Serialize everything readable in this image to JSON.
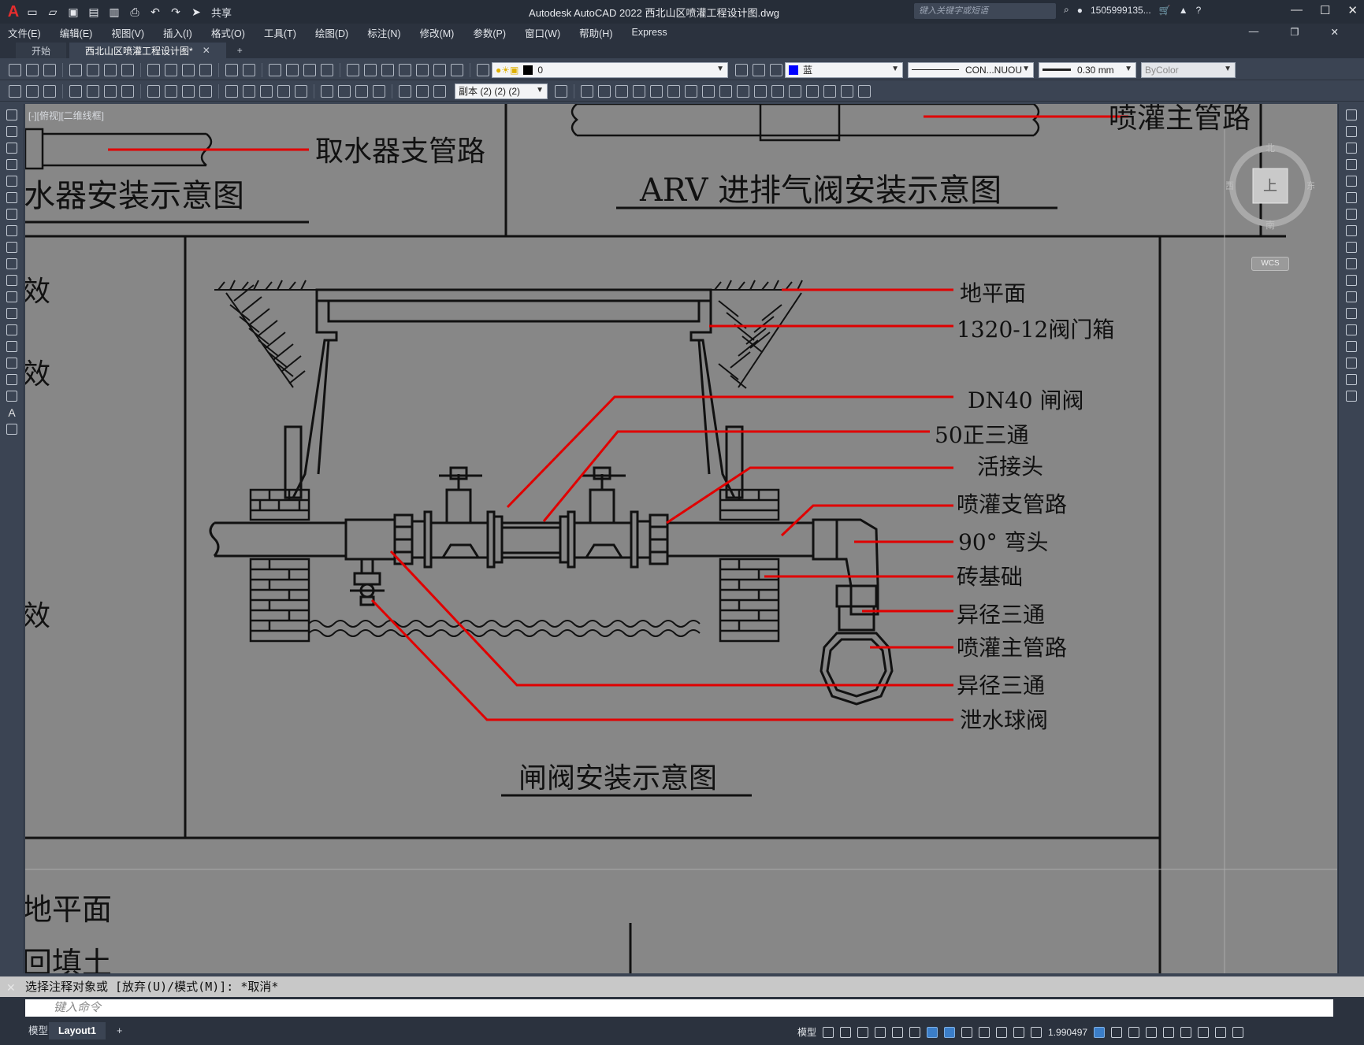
{
  "app": {
    "title": "Autodesk AutoCAD 2022    西北山区喷灌工程设计图.dwg",
    "share_label": "共享",
    "search_placeholder": "键入关键字或短语",
    "user": "1505999135...",
    "help": "?"
  },
  "menu": [
    "文件(E)",
    "编辑(E)",
    "视图(V)",
    "插入(I)",
    "格式(O)",
    "工具(T)",
    "绘图(D)",
    "标注(N)",
    "修改(M)",
    "参数(P)",
    "窗口(W)",
    "帮助(H)",
    "Express"
  ],
  "tabs": [
    {
      "label": "开始"
    },
    {
      "label": "西北山区喷灌工程设计图*"
    }
  ],
  "toolbar": {
    "layer": "0",
    "color_name": "蓝",
    "color_hex": "#0000ff",
    "linetype": "CON...NUOU",
    "lineweight": "0.30 mm",
    "plotstyle": "ByColor",
    "dimstyle": "副本 (2) (2) (2)"
  },
  "viewport_label": "[-][俯视][二维线框]",
  "viewcube": {
    "top": "上",
    "north": "北",
    "south": "南",
    "east": "东",
    "west": "西",
    "wcs": "WCS"
  },
  "drawing": {
    "top_left_label": "取水器支管路",
    "top_left_title": "水器安装示意图",
    "top_right_label": "喷灌主管路",
    "top_right_title": "ARV 进排气阀安装示意图",
    "main_title": "闸阀安装示意图",
    "callouts": [
      "地平面",
      "1320-12阀门箱",
      "DN40 闸阀",
      "50正三通",
      "活接头",
      "喷灌支管路",
      "90° 弯头",
      "砖基础",
      "异径三通",
      "喷灌主管路",
      "异径三通",
      "泄水球阀"
    ],
    "left_partial": [
      "效",
      "效",
      "效"
    ],
    "bottom_left": [
      "地平面",
      "回填土"
    ]
  },
  "command": {
    "history": "选择注释对象或 [放弃(U)/模式(M)]: *取消*",
    "placeholder": "键入命令"
  },
  "status": {
    "model_tab": "模型",
    "layout_tab": "Layout1",
    "model_button": "模型",
    "scale": "1.990497"
  }
}
